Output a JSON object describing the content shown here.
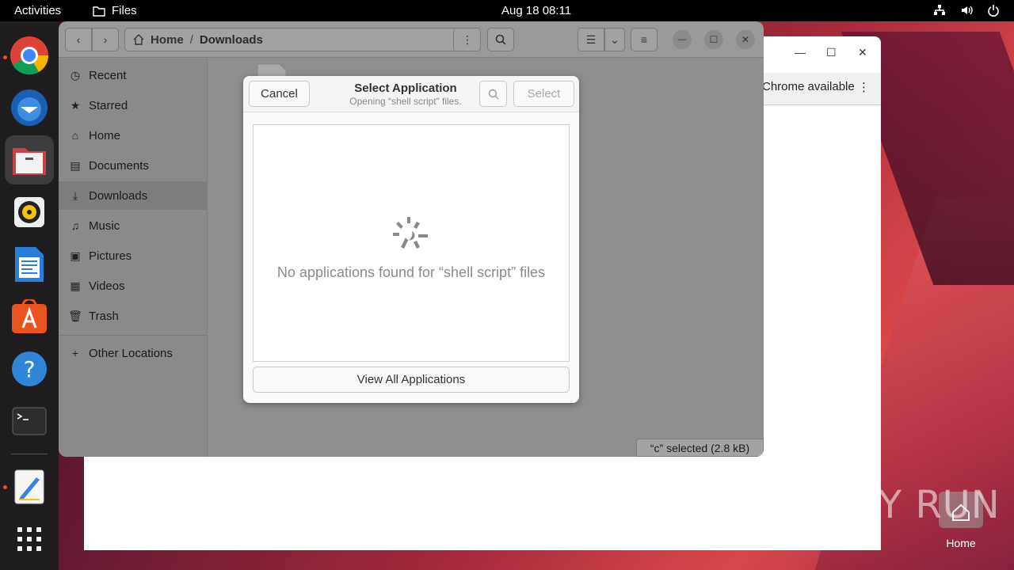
{
  "topbar": {
    "activities": "Activities",
    "app_name": "Files",
    "clock": "Aug 18  08:11"
  },
  "dock": {
    "items": [
      {
        "name": "Chrome"
      },
      {
        "name": "Thunderbird"
      },
      {
        "name": "Files"
      },
      {
        "name": "Rhythmbox"
      },
      {
        "name": "LibreOffice Writer"
      },
      {
        "name": "Ubuntu Software"
      },
      {
        "name": "Help"
      },
      {
        "name": "Terminal"
      },
      {
        "name": "Text Editor"
      },
      {
        "name": "Show Applications"
      }
    ]
  },
  "chrome_window": {
    "bar_text": "Chrome available"
  },
  "files": {
    "path": {
      "home": "Home",
      "separator": "/",
      "current": "Downloads"
    },
    "sidebar": [
      {
        "label": "Recent",
        "icon": "clock-icon"
      },
      {
        "label": "Starred",
        "icon": "star-icon"
      },
      {
        "label": "Home",
        "icon": "home-icon"
      },
      {
        "label": "Documents",
        "icon": "document-icon"
      },
      {
        "label": "Downloads",
        "icon": "download-icon"
      },
      {
        "label": "Music",
        "icon": "music-icon"
      },
      {
        "label": "Pictures",
        "icon": "picture-icon"
      },
      {
        "label": "Videos",
        "icon": "video-icon"
      },
      {
        "label": "Trash",
        "icon": "trash-icon"
      },
      {
        "label": "Other Locations",
        "icon": "plus-icon"
      }
    ],
    "status": "“c” selected  (2.8 kB)"
  },
  "dialog": {
    "cancel": "Cancel",
    "title": "Select Application",
    "subtitle": "Opening “shell script” files.",
    "select": "Select",
    "empty_message": "No applications found for “shell script” files",
    "view_all": "View All Applications"
  },
  "desktop": {
    "home_label": "Home",
    "watermark": "ANY RUN"
  },
  "colors": {
    "accent": "#e95420",
    "dialog_bg": "#fafafa"
  }
}
